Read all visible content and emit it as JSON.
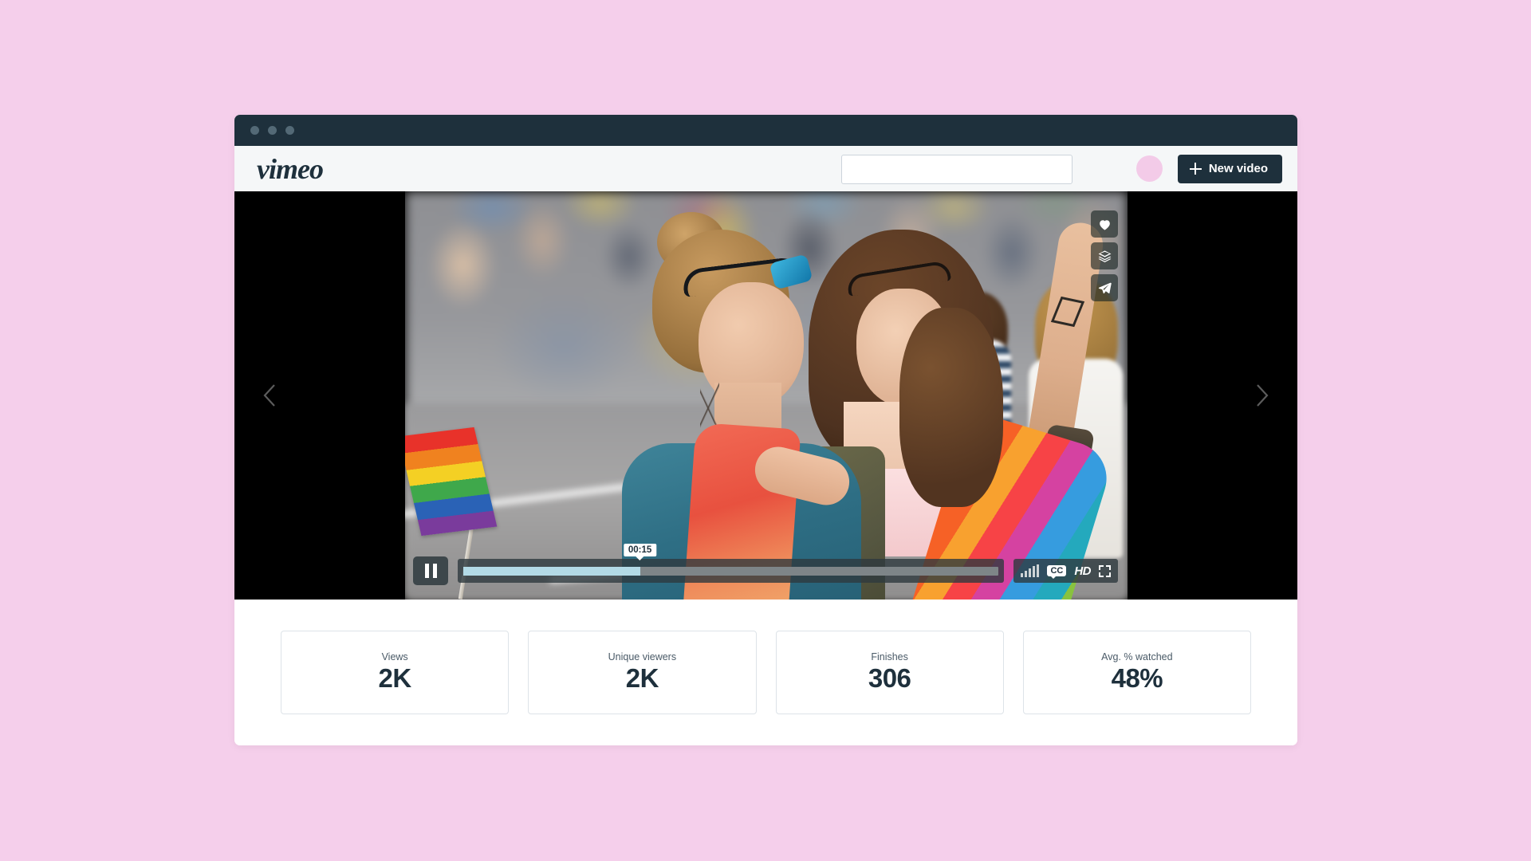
{
  "background_color": "#f5cfeb",
  "window": {
    "chrome_color": "#1e303c",
    "traffic_lights": [
      "close-dot",
      "minimize-dot",
      "maximize-dot"
    ]
  },
  "header": {
    "logo_text": "vimeo",
    "search": {
      "value": "",
      "placeholder": ""
    },
    "avatar": {
      "name": "user-avatar",
      "color": "#f3cbe8"
    },
    "new_video_button": {
      "label": "New video",
      "icon": "plus-icon"
    }
  },
  "player": {
    "video_description": "Two women at a pride parade, one holding a rainbow flag, the other wearing a rainbow scarf with arm raised",
    "overlay_actions": [
      {
        "name": "like",
        "icon": "heart-icon"
      },
      {
        "name": "watch-later",
        "icon": "layers-icon"
      },
      {
        "name": "share",
        "icon": "paper-plane-icon"
      }
    ],
    "nav": {
      "prev_icon": "chevron-left-icon",
      "next_icon": "chevron-right-icon"
    },
    "controls": {
      "play_state": "playing",
      "play_icon": "pause-icon",
      "current_time": "00:15",
      "progress_percent": 33,
      "volume_icon": "volume-bars-icon",
      "cc_label": "CC",
      "hd_label": "HD",
      "fullscreen_icon": "fullscreen-icon",
      "fill_color": "#b3dae6"
    }
  },
  "stats": {
    "cards": [
      {
        "label": "Views",
        "value": "2K"
      },
      {
        "label": "Unique viewers",
        "value": "2K"
      },
      {
        "label": "Finishes",
        "value": "306"
      },
      {
        "label": "Avg. % watched",
        "value": "48%"
      }
    ]
  }
}
